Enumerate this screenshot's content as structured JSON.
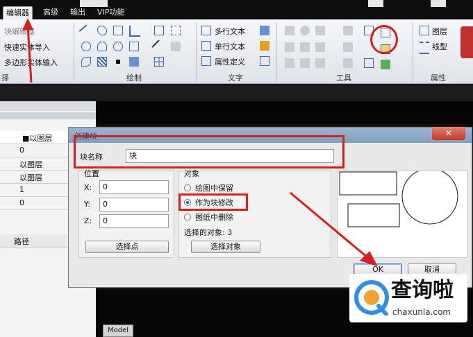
{
  "menu": {
    "tabs": [
      "编辑器",
      "高级",
      "输出",
      "VIP功能"
    ]
  },
  "ribbon": {
    "left_items": [
      "块编辑器",
      "快速实体导入",
      "多边形实体输入"
    ],
    "groups": [
      "绘制",
      "文字",
      "工具",
      "属性"
    ],
    "left_group_label": "择",
    "text_items": [
      "多行文本",
      "单行文本",
      "属性定义"
    ],
    "prop_items": [
      "图层",
      "线型"
    ]
  },
  "left_panel": {
    "layer_header": "■以图层",
    "rows": [
      "0",
      "以图层",
      "以图层",
      "1",
      "0"
    ],
    "path_header": "路径"
  },
  "canvas": {
    "model_tab": "Model"
  },
  "dialog": {
    "title": "创建块",
    "close": "✕",
    "name_label": "块名称",
    "name_value": "块",
    "position": {
      "title": "位置",
      "x_label": "X:",
      "x_value": "0",
      "y_label": "Y:",
      "y_value": "0",
      "z_label": "Z:",
      "z_value": "0",
      "pick_button": "选择点"
    },
    "objects": {
      "title": "对象",
      "options": [
        "绘图中保留",
        "作为块修改",
        "图纸中删除"
      ],
      "selected_index": 1,
      "count_text": "选择的对象: 3",
      "select_button": "选择对象"
    },
    "ok": "OK",
    "cancel": "取消"
  },
  "watermark": {
    "brand": "查询啦",
    "url": "chaxunla.com"
  },
  "colors": {
    "annotation_red": "#d81e1e",
    "accent_blue": "#3b63b8"
  }
}
